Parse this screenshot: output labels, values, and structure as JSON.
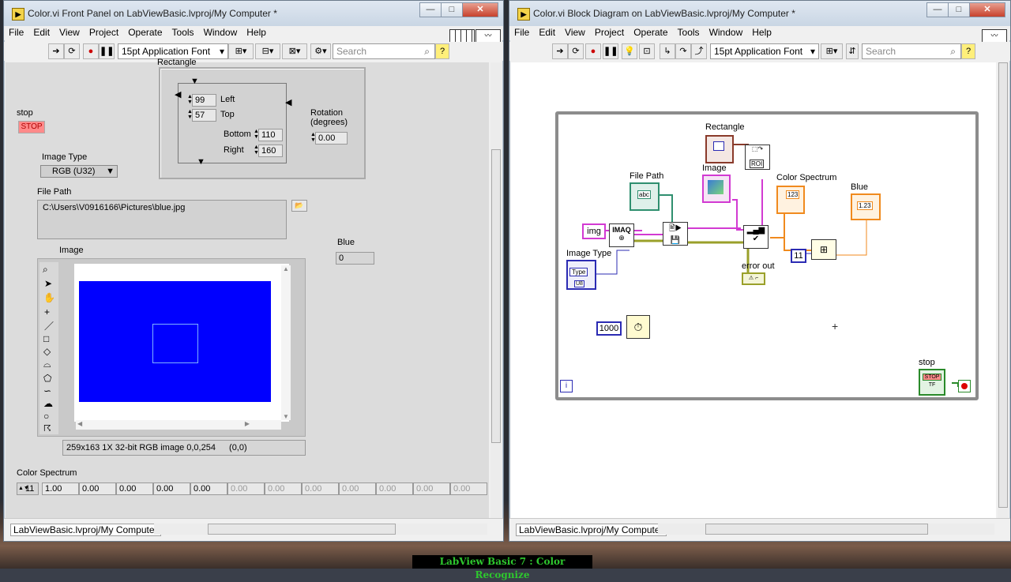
{
  "left_window": {
    "title": "Color.vi Front Panel on LabViewBasic.lvproj/My Computer *",
    "menu": [
      "File",
      "Edit",
      "View",
      "Project",
      "Operate",
      "Tools",
      "Window",
      "Help"
    ],
    "font_select": "15pt Application Font",
    "search_placeholder": "Search",
    "status_project": "LabViewBasic.lvproj/My Computer",
    "rectangle": {
      "label": "Rectangle",
      "left_label": "Left",
      "left_value": "99",
      "top_label": "Top",
      "top_value": "57",
      "bottom_label": "Bottom",
      "bottom_value": "110",
      "right_label": "Right",
      "right_value": "160",
      "rotation_label": "Rotation\n(degrees)",
      "rotation_value": "0.00"
    },
    "stop": {
      "label": "stop",
      "button": "STOP"
    },
    "image_type": {
      "label": "Image Type",
      "value": "RGB (U32)"
    },
    "file_path": {
      "label": "File Path",
      "value": "C:\\Users\\V0916166\\Pictures\\blue.jpg"
    },
    "image": {
      "label": "Image",
      "status": "259x163 1X 32-bit RGB image 0,0,254",
      "coords": "(0,0)",
      "fill_color": "#0000ff"
    },
    "blue": {
      "label": "Blue",
      "value": "0"
    },
    "color_spectrum": {
      "label": "Color Spectrum",
      "index": "11",
      "values": [
        "1.00",
        "0.00",
        "0.00",
        "0.00",
        "0.00",
        "0.00",
        "0.00",
        "0.00",
        "0.00",
        "0.00",
        "0.00",
        "0.00"
      ]
    }
  },
  "right_window": {
    "title": "Color.vi Block Diagram on LabViewBasic.lvproj/My Computer *",
    "menu": [
      "File",
      "Edit",
      "View",
      "Project",
      "Operate",
      "Tools",
      "Window",
      "Help"
    ],
    "font_select": "15pt Application Font",
    "search_placeholder": "Search",
    "status_project": "LabViewBasic.lvproj/My Computer",
    "nodes": {
      "rectangle": "Rectangle",
      "image": "Image",
      "file_path": "File Path",
      "color_spectrum": "Color Spectrum",
      "blue": "Blue",
      "img_const": "img",
      "imaq": "IMAQ",
      "roi": "ROI",
      "image_type": "Image Type",
      "type_const": "Type",
      "error_out": "error out",
      "const_11": "11",
      "const_1000": "1000",
      "stop": "stop",
      "loop_iter": "i",
      "stop_btn": "STOP",
      "blue_ind": "1.23",
      "spectrum_ind": "123",
      "path_ind": "abc",
      "type_sub": "U8",
      "tf": "TF",
      "dbl": "DBL"
    }
  },
  "banner": "LabView Basic 7 : Color Recognize",
  "colors": {
    "accent_stop": "#ff7070",
    "image_fill": "#0000ff",
    "wire_orange": "#f08a1e",
    "wire_pink": "#d23ad2",
    "wire_green": "#2f8f6f"
  }
}
